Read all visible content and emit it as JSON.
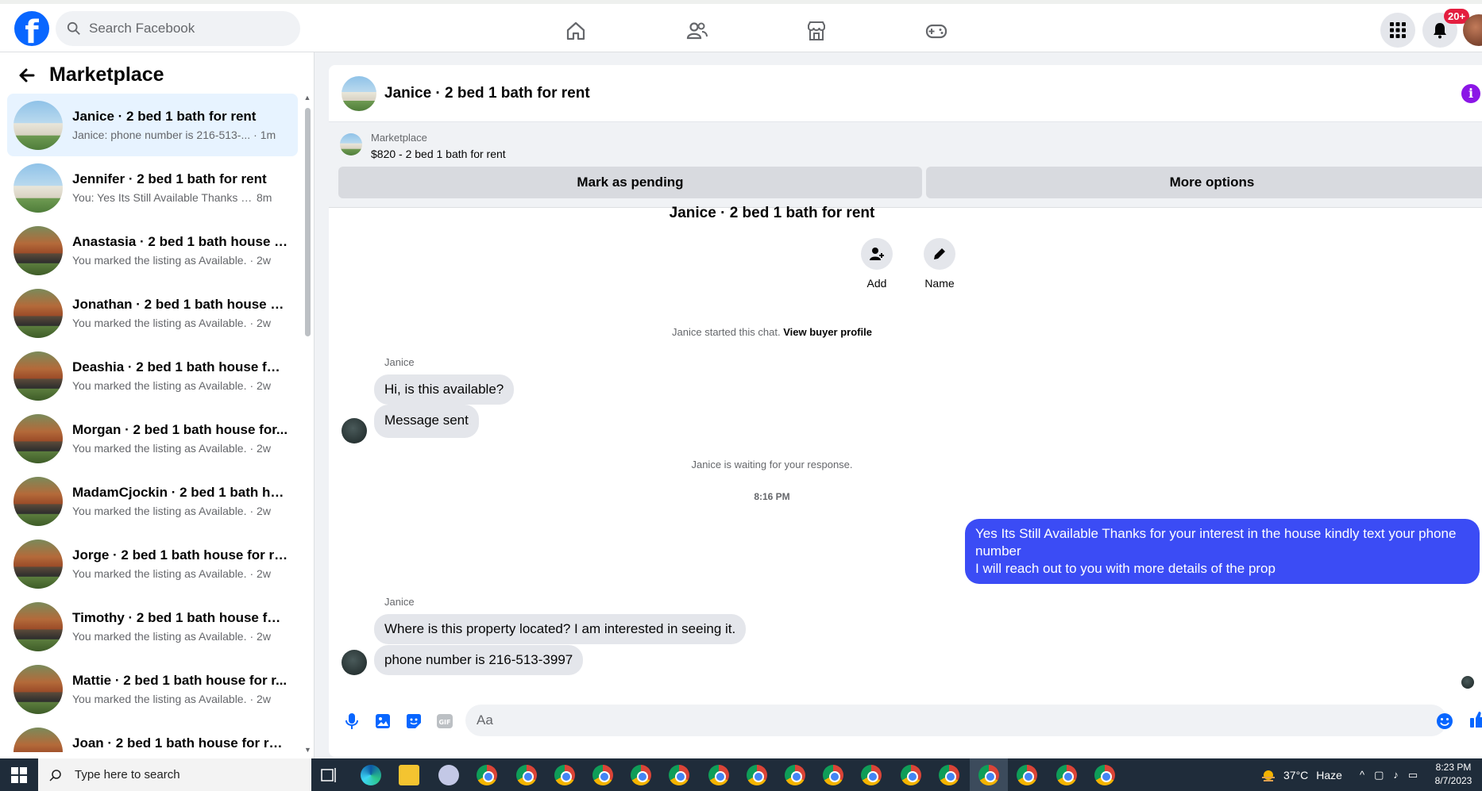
{
  "topbar": {
    "logo": "f",
    "search_placeholder": "Search Facebook",
    "notification_count": "20+"
  },
  "sidebar": {
    "title": "Marketplace",
    "conversations": [
      {
        "title": "Janice · 2 bed 1 bath for rent",
        "snippet": "Janice: phone number is 216-513-...",
        "time": "· 1m",
        "thumb": "house1",
        "active": true
      },
      {
        "title": "Jennifer · 2 bed 1 bath for rent",
        "snippet": "You: Yes Its Still Available Thanks fo...",
        "time": "8m",
        "thumb": "house1",
        "active": false
      },
      {
        "title": "Anastasia · 2 bed 1 bath house f...",
        "snippet": "You marked the listing as Available.",
        "time": "· 2w",
        "thumb": "house2",
        "active": false
      },
      {
        "title": "Jonathan · 2 bed 1 bath house fo...",
        "snippet": "You marked the listing as Available.",
        "time": "· 2w",
        "thumb": "house2",
        "active": false
      },
      {
        "title": "Deashia · 2 bed 1 bath house for ...",
        "snippet": "You marked the listing as Available.",
        "time": "· 2w",
        "thumb": "house2",
        "active": false
      },
      {
        "title": "Morgan · 2 bed 1 bath house for...",
        "snippet": "You marked the listing as Available.",
        "time": "· 2w",
        "thumb": "house2",
        "active": false
      },
      {
        "title": "MadamCjockin · 2 bed 1 bath ho...",
        "snippet": "You marked the listing as Available.",
        "time": "· 2w",
        "thumb": "house2",
        "active": false
      },
      {
        "title": "Jorge · 2 bed 1 bath house for rent",
        "snippet": "You marked the listing as Available.",
        "time": "· 2w",
        "thumb": "house2",
        "active": false
      },
      {
        "title": "Timothy · 2 bed 1 bath house for...",
        "snippet": "You marked the listing as Available.",
        "time": "· 2w",
        "thumb": "house2",
        "active": false
      },
      {
        "title": "Mattie · 2 bed 1 bath house for r...",
        "snippet": "You marked the listing as Available.",
        "time": "· 2w",
        "thumb": "house2",
        "active": false
      },
      {
        "title": "Joan · 2 bed 1 bath house for rent",
        "snippet": "You marked the listing as Available.",
        "time": "· 2w",
        "thumb": "house2",
        "active": false
      }
    ]
  },
  "chat": {
    "header_title": "Janice · 2 bed 1 bath for rent",
    "listing": {
      "category": "Marketplace",
      "price_title": "$820 - 2 bed 1 bath for rent",
      "mark_pending_label": "Mark as pending",
      "more_options_label": "More options"
    },
    "center_title": "Janice · 2 bed 1 bath for rent",
    "actions": {
      "add_label": "Add",
      "name_label": "Name"
    },
    "started_text": "Janice started this chat.",
    "view_profile_link": "View buyer profile",
    "sender1": "Janice",
    "msg1": "Hi, is this available?",
    "msg2": "Message sent",
    "waiting_text": "Janice is waiting for your response.",
    "timestamp": "8:16 PM",
    "outgoing_line1": "Yes Its Still Available Thanks for your interest in the house kindly  text your phone number",
    "outgoing_line2": "I will reach out to you with more details of the prop",
    "sender2": "Janice",
    "msg3": "Where is this property located?  I am interested in seeing it.",
    "msg4": "phone number is 216-513-3997",
    "composer_placeholder": "Aa"
  },
  "taskbar": {
    "search_placeholder": "Type here to search",
    "temperature": "37°C",
    "weather": "Haze",
    "time": "8:23 PM",
    "date": "8/7/2023"
  },
  "colors": {
    "brand": "#0866ff",
    "outgoing_bubble": "#3b4cf5",
    "incoming_bubble": "#e4e6eb",
    "badge": "#e41e3f",
    "info_icon": "#8b16e6"
  }
}
